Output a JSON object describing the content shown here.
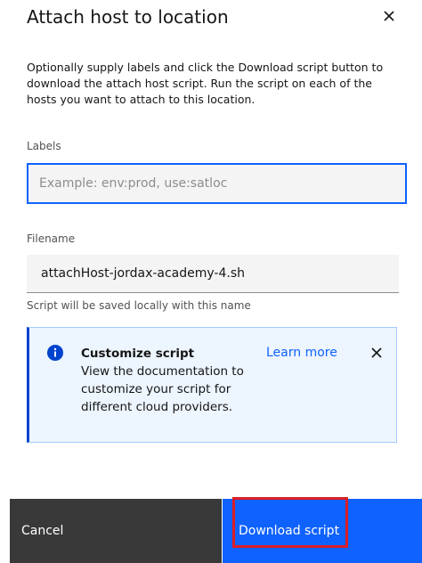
{
  "modal": {
    "title": "Attach host to location",
    "description": "Optionally supply labels and click the Download script button to download the attach host script. Run the script on each of the hosts you want to attach to this location."
  },
  "labels_field": {
    "label": "Labels",
    "placeholder": "Example: env:prod, use:satloc",
    "value": ""
  },
  "filename_field": {
    "label": "Filename",
    "value": "attachHost-jordax-academy-4.sh",
    "helper": "Script will be saved locally with this name"
  },
  "notification": {
    "title": "Customize script",
    "body": "View the documentation to customize your script for different cloud providers.",
    "link": "Learn more"
  },
  "footer": {
    "cancel_label": "Cancel",
    "download_label": "Download script"
  },
  "colors": {
    "primary": "#0f62fe",
    "secondary_button": "#393939",
    "info_background": "#edf5ff",
    "info_accent": "#0043ce",
    "highlight": "#da1e28"
  },
  "icons": {
    "modal_close": "close-icon",
    "notification": "info-icon",
    "notification_close": "close-icon"
  }
}
